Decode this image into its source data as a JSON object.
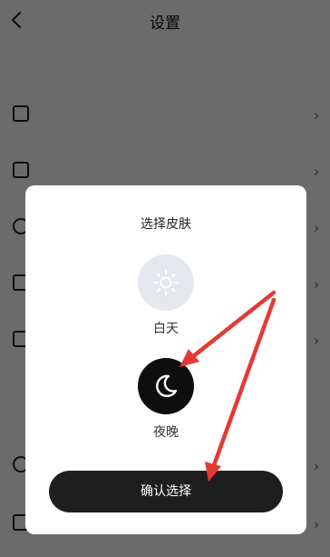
{
  "header": {
    "title": "设置",
    "back_icon": "chevron-left-icon"
  },
  "modal": {
    "title": "选择皮肤",
    "options": [
      {
        "label": "白天",
        "icon": "sun-icon",
        "selected": false
      },
      {
        "label": "夜晚",
        "icon": "moon-icon",
        "selected": true
      }
    ],
    "confirm_label": "确认选择"
  },
  "colors": {
    "overlay": "#000000",
    "day_circle": "#e5e9ee",
    "night_circle": "#0e0e0e",
    "confirm_button": "#1e1e1e",
    "annotation_arrow": "#e53935"
  }
}
